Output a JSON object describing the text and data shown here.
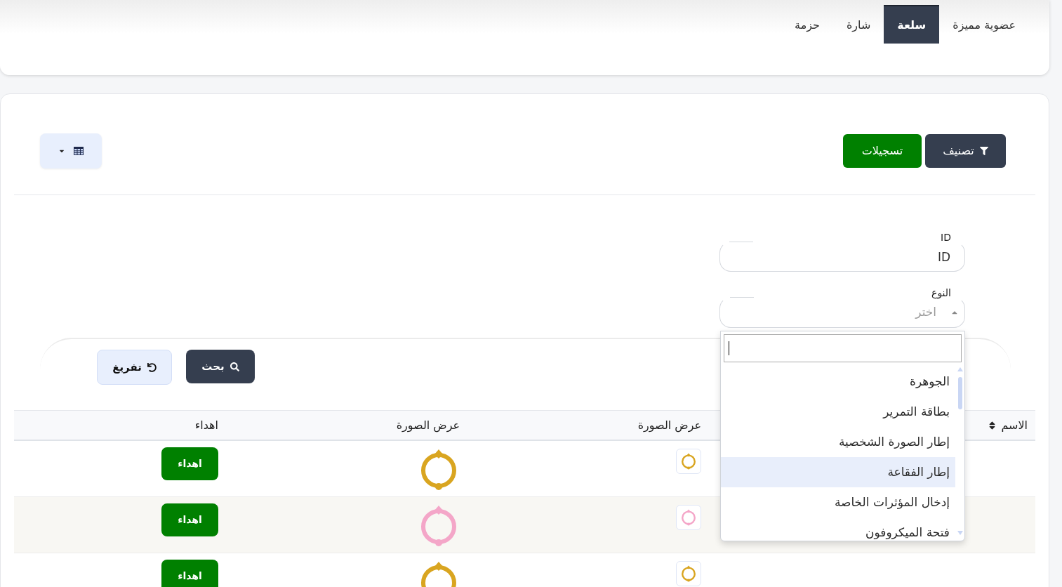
{
  "tabs": [
    {
      "label": "عضوية مميزة",
      "selected": false
    },
    {
      "label": "سلعة",
      "selected": true
    },
    {
      "label": "شارة",
      "selected": false
    },
    {
      "label": "حزمة",
      "selected": false
    }
  ],
  "toolbar": {
    "filter_button": "تصنيف",
    "records_button": "تسجيلات"
  },
  "filters": [
    {
      "kind": "text",
      "label": "ID",
      "placeholder": "ID"
    },
    {
      "kind": "select",
      "label": "النوع",
      "placeholder": "اختر",
      "expanded": true,
      "options": [
        {
          "label": "الجوهرة",
          "highlighted": false
        },
        {
          "label": "بطاقة التمرير",
          "highlighted": false
        },
        {
          "label": "إطار الصورة الشخصية",
          "highlighted": false
        },
        {
          "label": "إطار الفقاعة",
          "highlighted": true
        },
        {
          "label": "إدخال المؤثرات الخاصة",
          "highlighted": false
        },
        {
          "label": "فتحة الميكروفون",
          "highlighted": false
        }
      ]
    }
  ],
  "search_actions": {
    "search_button": "بحث",
    "reset_button": "تفريغ"
  },
  "table": {
    "columns": [
      {
        "label": "الاسم",
        "sortable": true
      },
      {
        "label": "عرض الصورة",
        "sortable": false
      },
      {
        "label": "عرض الصورة",
        "sortable": false
      },
      {
        "label": "اهداء",
        "sortable": false
      }
    ],
    "rows": [
      {
        "color": "#d9a520",
        "action": "اهداء"
      },
      {
        "color": "#f4a6c8",
        "action": "اهداء"
      },
      {
        "color": "#d9a520",
        "action": "اهداء"
      }
    ]
  }
}
